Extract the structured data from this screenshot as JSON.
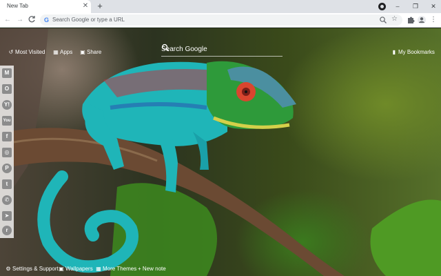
{
  "browser": {
    "tab_title": "New Tab",
    "tab_close_glyph": "✕",
    "new_tab_glyph": "+",
    "window_controls": {
      "minimize": "–",
      "maximize": "❐",
      "close": "✕"
    },
    "toolbar": {
      "back_glyph": "←",
      "forward_glyph": "→",
      "reload_glyph": "C",
      "omnibox_placeholder": "Search Google or type a URL",
      "google_glyph": "G",
      "star_glyph": "☆",
      "menu_glyph": "⋮"
    }
  },
  "newtab": {
    "top_links": {
      "most_visited": {
        "label": "Most Visited",
        "icon": "history-icon"
      },
      "apps": {
        "label": "Apps",
        "icon": "apps-grid-icon"
      },
      "share": {
        "label": "Share",
        "icon": "share-icon"
      },
      "bookmarks": {
        "label": "My Bookmarks",
        "icon": "bookmark-icon"
      }
    },
    "search": {
      "placeholder": "Search Google"
    },
    "social_bar": [
      {
        "name": "gmail",
        "glyph": "M"
      },
      {
        "name": "outlook",
        "glyph": "O"
      },
      {
        "name": "yahoo",
        "glyph": "Y!"
      },
      {
        "name": "youtube",
        "glyph": "You"
      },
      {
        "name": "facebook",
        "glyph": "f"
      },
      {
        "name": "instagram",
        "glyph": "◎"
      },
      {
        "name": "pinterest",
        "glyph": "P"
      },
      {
        "name": "twitter",
        "glyph": "t"
      },
      {
        "name": "whatsapp",
        "glyph": "✆"
      },
      {
        "name": "telegram",
        "glyph": "➤"
      },
      {
        "name": "reddit",
        "glyph": "r"
      }
    ],
    "bottom_links": {
      "settings": {
        "label": "Settings & Support",
        "icon": "gear-icon",
        "glyph": "⚙"
      },
      "wallpapers": {
        "label": "Wallpapers",
        "icon": "image-icon",
        "glyph": "▣"
      },
      "more_themes": {
        "label": "More Themes",
        "icon": "grid-icon",
        "glyph": "▦"
      },
      "new_note": {
        "label": "+ New note"
      }
    }
  },
  "colors": {
    "chrome_bg": "#dee1e6",
    "omnibox_bg": "#f1f3f4",
    "chameleon_body": "#1fb5b8",
    "chameleon_head": "#2e9a3a",
    "branch": "#6b4a33"
  }
}
